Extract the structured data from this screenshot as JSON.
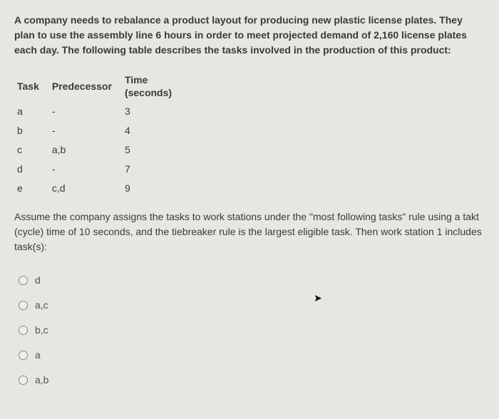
{
  "intro": "A company needs to rebalance a product layout for producing new plastic license plates. They plan to use the assembly line 6 hours in order to meet projected demand of 2,160 license plates each day. The following table describes the tasks involved in the production of this product:",
  "table": {
    "headers": {
      "task": "Task",
      "predecessor": "Predecessor",
      "time_line1": "Time",
      "time_line2": "(seconds)"
    },
    "rows": [
      {
        "task": "a",
        "predecessor": "-",
        "time": "3"
      },
      {
        "task": "b",
        "predecessor": "-",
        "time": "4"
      },
      {
        "task": "c",
        "predecessor": "a,b",
        "time": "5"
      },
      {
        "task": "d",
        "predecessor": "-",
        "time": "7"
      },
      {
        "task": "e",
        "predecessor": "c,d",
        "time": "9"
      }
    ]
  },
  "instruction": "Assume the company assigns the tasks to work stations under the \"most following tasks\" rule using a takt (cycle) time of 10 seconds, and the tiebreaker rule is the largest eligible task. Then work station 1 includes task(s):",
  "options": [
    {
      "label": "d"
    },
    {
      "label": "a,c"
    },
    {
      "label": "b,c"
    },
    {
      "label": "a"
    },
    {
      "label": "a,b"
    }
  ]
}
